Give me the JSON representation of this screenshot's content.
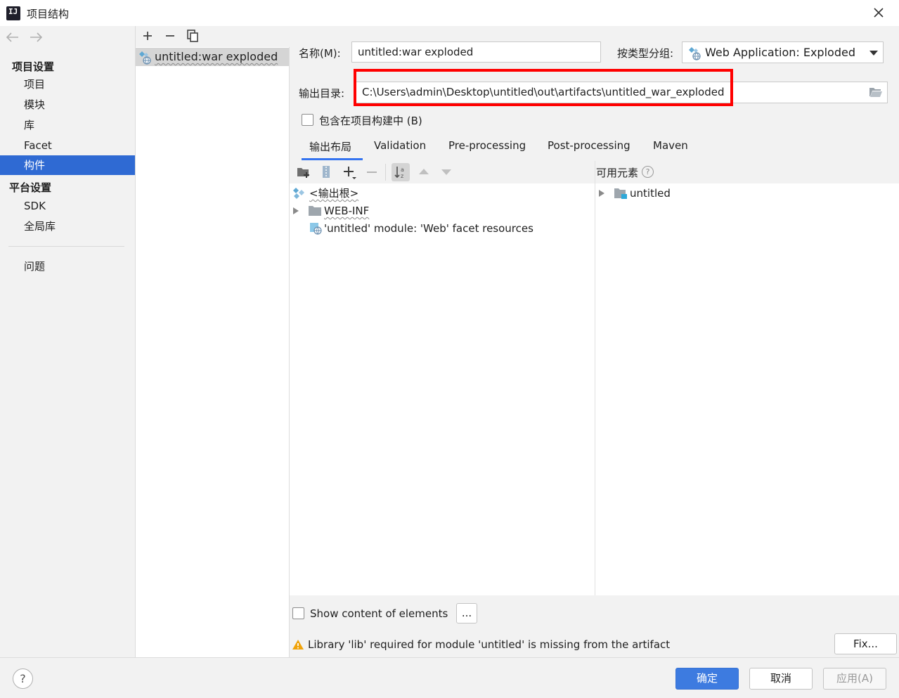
{
  "window": {
    "title": "项目结构",
    "logo_text": "IJ"
  },
  "sidebar": {
    "sections": [
      {
        "header": "项目设置",
        "items": [
          "项目",
          "模块",
          "库",
          "Facet",
          "构件"
        ]
      },
      {
        "header": "平台设置",
        "items": [
          "SDK",
          "全局库"
        ]
      }
    ],
    "extra_item": "问题",
    "selected": "构件"
  },
  "artifact_list": {
    "items": [
      {
        "label": "untitled:war exploded",
        "selected": true
      }
    ]
  },
  "form": {
    "name_label": "名称(M):",
    "name_value": "untitled:war exploded",
    "type_label": "按类型分组:",
    "type_value": "Web Application: Exploded",
    "output_label": "输出目录:",
    "output_value": "C:\\Users\\admin\\Desktop\\untitled\\out\\artifacts\\untitled_war_exploded",
    "include_label": "包含在项目构建中 (B)",
    "include_checked": false
  },
  "tabs": [
    "输出布局",
    "Validation",
    "Pre-processing",
    "Post-processing",
    "Maven"
  ],
  "active_tab": "输出布局",
  "layout_tree": [
    {
      "label": "<输出根>",
      "icon": "artifact-root-icon"
    },
    {
      "label": "WEB-INF",
      "icon": "folder-icon",
      "collapsed": true
    },
    {
      "label": "'untitled' module: 'Web' facet resources",
      "icon": "web-facet-icon"
    }
  ],
  "available": {
    "header": "可用元素",
    "help_glyph": "?",
    "items": [
      {
        "label": "untitled",
        "icon": "module-folder-icon",
        "collapsed": true
      }
    ]
  },
  "show_content": {
    "label": "Show content of elements",
    "checked": false,
    "more_button": "..."
  },
  "warning": {
    "text": "Library 'lib' required for module 'untitled' is missing from the artifact",
    "fix_button": "Fix..."
  },
  "footer": {
    "help": "?",
    "ok": "确定",
    "cancel": "取消",
    "apply": "应用(A)"
  },
  "colors": {
    "accent": "#3574f0",
    "selection": "#2f6ad3",
    "highlight": "#ff0000",
    "warning": "#f0a30a"
  }
}
